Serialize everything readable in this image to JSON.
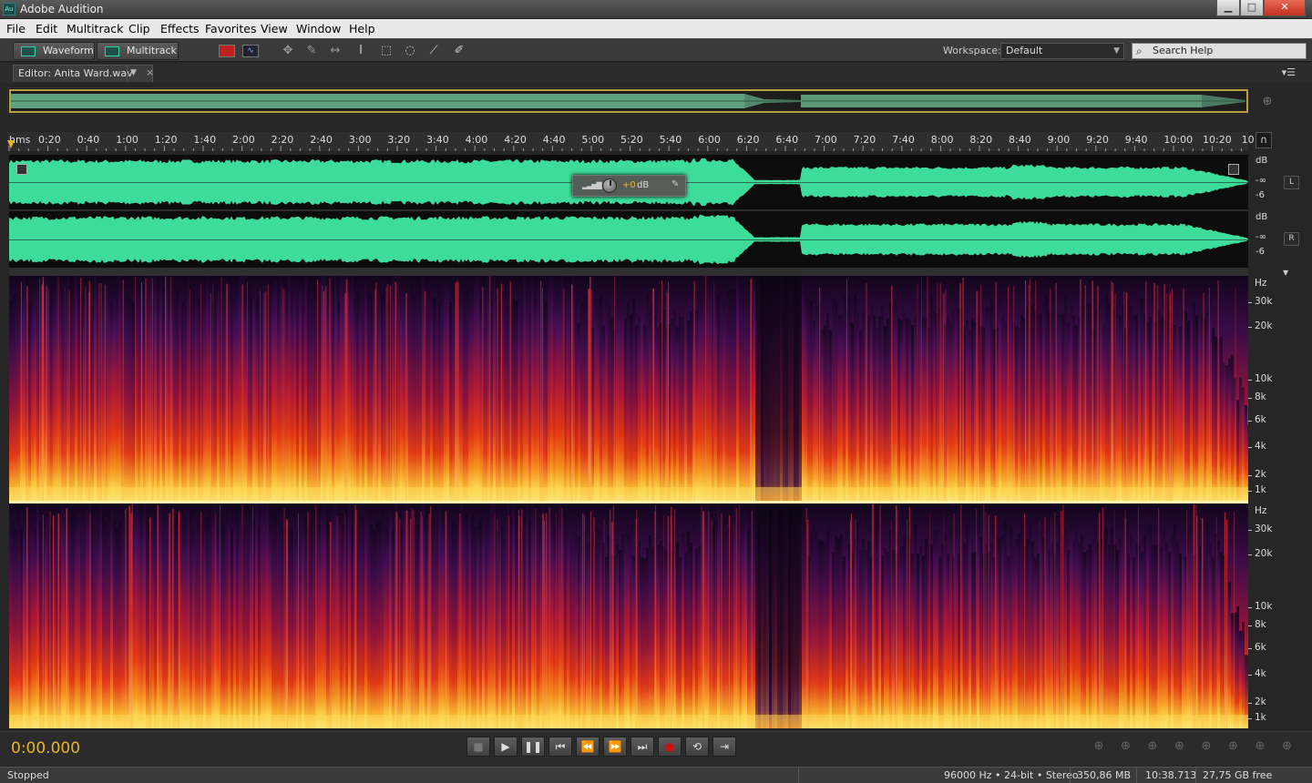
{
  "window": {
    "title": "Adobe Audition",
    "icon_text": "Au",
    "min": "▁",
    "max": "□",
    "close": "✕"
  },
  "menu": [
    "File",
    "Edit",
    "Multitrack",
    "Clip",
    "Effects",
    "Favorites",
    "View",
    "Window",
    "Help"
  ],
  "toolbar": {
    "waveform_label": "Waveform",
    "multitrack_label": "Multitrack",
    "workspace_label": "Workspace:",
    "workspace_value": "Default",
    "search_placeholder": "Search Help",
    "icons": [
      "spectral-frequency-icon",
      "spectral-pitch-icon",
      "move-tool-icon",
      "razor-tool-icon",
      "slip-tool-icon",
      "time-selection-tool-icon",
      "marquee-selection-tool-icon",
      "lasso-selection-tool-icon",
      "brush-selection-tool-icon",
      "spot-healing-brush-icon"
    ]
  },
  "editor": {
    "tab_label": "Editor: Anita Ward.wav"
  },
  "ruler": {
    "unit": "hms",
    "labels": [
      "0:20",
      "0:40",
      "1:00",
      "1:20",
      "1:40",
      "2:00",
      "2:20",
      "2:40",
      "3:00",
      "3:20",
      "3:40",
      "4:00",
      "4:20",
      "4:40",
      "5:00",
      "5:20",
      "5:40",
      "6:00",
      "6:20",
      "6:40",
      "7:00",
      "7:20",
      "7:40",
      "8:00",
      "8:20",
      "8:40",
      "9:00",
      "9:20",
      "9:40",
      "10:00",
      "10:20",
      "10"
    ]
  },
  "hud": {
    "value": "+0",
    "unit": "dB"
  },
  "channels": [
    {
      "badge": "L",
      "db_labels": [
        "dB",
        "-∞",
        "-6"
      ]
    },
    {
      "badge": "R",
      "db_labels": [
        "dB",
        "-∞",
        "-6"
      ]
    }
  ],
  "hz_labels": [
    "Hz",
    "30k",
    "20k",
    "10k",
    "8k",
    "6k",
    "4k",
    "2k",
    "1k"
  ],
  "transport": {
    "timecode": "0:00.000",
    "buttons": [
      "stop-button",
      "play-button",
      "pause-button",
      "go-to-start-button",
      "rewind-button",
      "fast-forward-button",
      "go-to-end-button",
      "record-button",
      "loop-button",
      "skip-selection-button"
    ],
    "symbols": [
      "■",
      "▶",
      "❚❚",
      "⏮",
      "⏪",
      "⏩",
      "⏭",
      "●",
      "⟲",
      "⇥"
    ]
  },
  "status": {
    "state": "Stopped",
    "sample_info": "96000 Hz • 24-bit • Stereo",
    "file_size": "350,86 MB",
    "duration": "10:38.713",
    "free_space": "27,75 GB free"
  },
  "colors": {
    "waveform": "#3edc9a",
    "timecode": "#e8b52a",
    "record": "#d01010",
    "accent": "#2ed2a0"
  }
}
